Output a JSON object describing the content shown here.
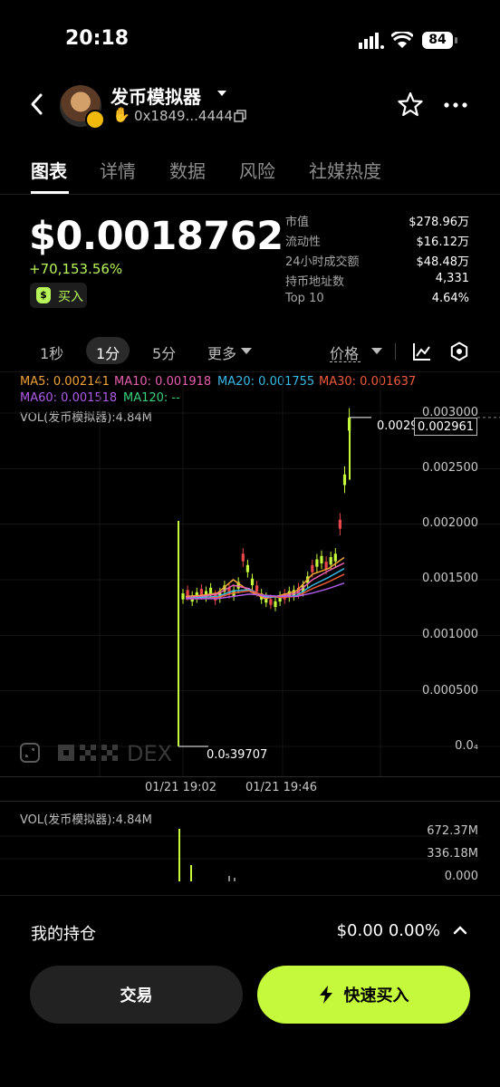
{
  "status_bar": {
    "time": "20:18",
    "battery": "84"
  },
  "header": {
    "token_name": "发币模拟器",
    "address": "0x1849...4444"
  },
  "tabs": [
    {
      "label": "图表",
      "active": true
    },
    {
      "label": "详情",
      "active": false
    },
    {
      "label": "数据",
      "active": false
    },
    {
      "label": "风险",
      "active": false
    },
    {
      "label": "社媒热度",
      "active": false
    }
  ],
  "price": {
    "value": "$0.0018762",
    "change": "+70,153.56%",
    "buy_label": "买入"
  },
  "stats": [
    {
      "label": "市值",
      "value": "$278.96万"
    },
    {
      "label": "流动性",
      "value": "$16.12万"
    },
    {
      "label": "24小时成交额",
      "value": "$48.48万"
    },
    {
      "label": "持币地址数",
      "value": "4,331"
    },
    {
      "label": "Top 10",
      "value": "4.64%"
    }
  ],
  "intervals": {
    "one_sec": "1秒",
    "one_min": "1分",
    "five_min": "5分",
    "more": "更多",
    "price_mode": "价格"
  },
  "ma": {
    "ma5": "MA5: 0.002141",
    "ma10": "MA10: 0.001918",
    "ma20": "MA20: 0.001755",
    "ma30": "MA30: 0.001637",
    "ma60": "MA60: 0.001518",
    "ma120": "MA120: --"
  },
  "vol_label": "VOL(发币模拟器):4.84M",
  "colors": {
    "ma5": "#f2a33a",
    "ma10": "#e85fb0",
    "ma20": "#38b9e8",
    "ma30": "#f05b3a",
    "ma60": "#b05be8",
    "ma120": "#39d17a",
    "candle": "#c4f93c",
    "accent": "#c4f93c"
  },
  "chart_data": {
    "type": "line",
    "title": "",
    "xlabel": "",
    "ylabel": "",
    "ylim": [
      0,
      0.003
    ],
    "y_ticks": [
      "0.003000",
      "0.002500",
      "0.002000",
      "0.001500",
      "0.001000",
      "0.000500",
      "0.0₄"
    ],
    "x_ticks": [
      "01/21 19:02",
      "01/21 19:46"
    ],
    "high_label": "0.0029",
    "current_label": "0.002961",
    "low_label": "0.0₅39707",
    "watermark": "DEX",
    "series": [
      {
        "name": "MA5",
        "values": [
          0.00135,
          0.00136,
          0.00138,
          0.0015,
          0.0014,
          0.00133,
          0.00136,
          0.0014,
          0.00155,
          0.0016,
          0.0017
        ]
      },
      {
        "name": "MA10",
        "values": [
          0.00134,
          0.00135,
          0.00137,
          0.00145,
          0.00142,
          0.00134,
          0.00135,
          0.00138,
          0.0015,
          0.00158,
          0.00165
        ]
      },
      {
        "name": "MA20",
        "values": [
          0.00133,
          0.00134,
          0.00135,
          0.0014,
          0.00141,
          0.00135,
          0.00134,
          0.00136,
          0.00145,
          0.00152,
          0.0016
        ]
      },
      {
        "name": "MA30",
        "values": [
          0.00133,
          0.00133,
          0.00134,
          0.00138,
          0.0014,
          0.00136,
          0.00134,
          0.00135,
          0.00142,
          0.00148,
          0.00155
        ]
      },
      {
        "name": "MA60",
        "values": [
          0.00133,
          0.00133,
          0.00133,
          0.00135,
          0.00137,
          0.00136,
          0.00135,
          0.00135,
          0.00138,
          0.00142,
          0.00147
        ]
      }
    ]
  },
  "volume_ticks": [
    "672.37M",
    "336.18M",
    "0.000"
  ],
  "holding": {
    "label": "我的持仓",
    "value": "$0.00 0.00%"
  },
  "buttons": {
    "trade": "交易",
    "quick_buy": "快速买入"
  }
}
